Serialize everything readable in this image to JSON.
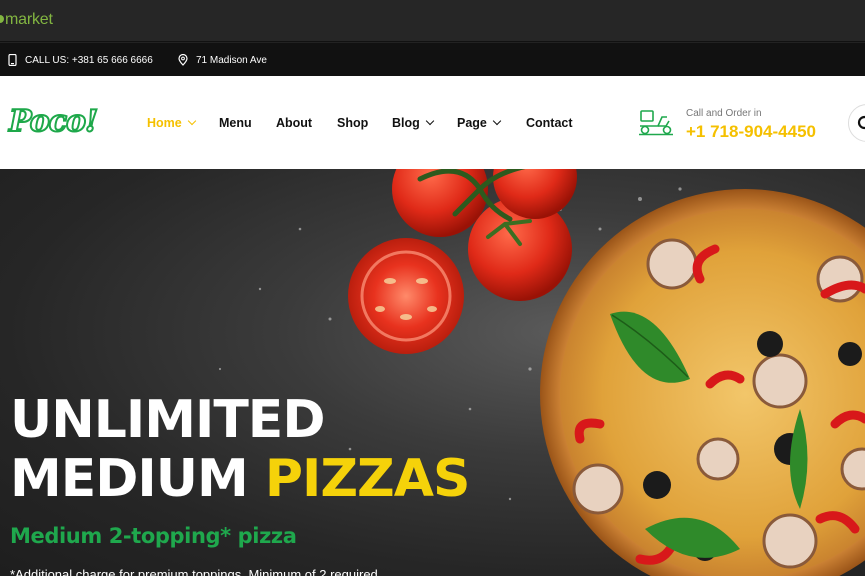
{
  "topbar": {
    "brand": "market"
  },
  "infobar": {
    "phone": "CALL US: +381 65 666 6666",
    "address": "71 Madison Ave"
  },
  "header": {
    "logo": "Poco!",
    "nav": [
      {
        "label": "Home",
        "dropdown": true,
        "active": true
      },
      {
        "label": "Menu",
        "dropdown": false
      },
      {
        "label": "About",
        "dropdown": false
      },
      {
        "label": "Shop",
        "dropdown": false
      },
      {
        "label": "Blog",
        "dropdown": true
      },
      {
        "label": "Page",
        "dropdown": true
      },
      {
        "label": "Contact",
        "dropdown": false
      }
    ],
    "call_label": "Call and Order in",
    "call_phone": "+1 718-904-4450"
  },
  "hero": {
    "headline_line1": "UNLIMITED",
    "headline_line2_a": "MEDIUM ",
    "headline_line2_b": "PIZZAS",
    "subtitle": "Medium 2-topping* pizza",
    "note": "*Additional charge for premium toppings. Minimum of 2 required."
  },
  "colors": {
    "accent": "#f5c000",
    "green": "#1fa84d",
    "dark": "#111111"
  },
  "icons": [
    "phone-icon",
    "location-pin-icon",
    "delivery-scooter-icon",
    "search-icon",
    "chevron-down-icon"
  ]
}
